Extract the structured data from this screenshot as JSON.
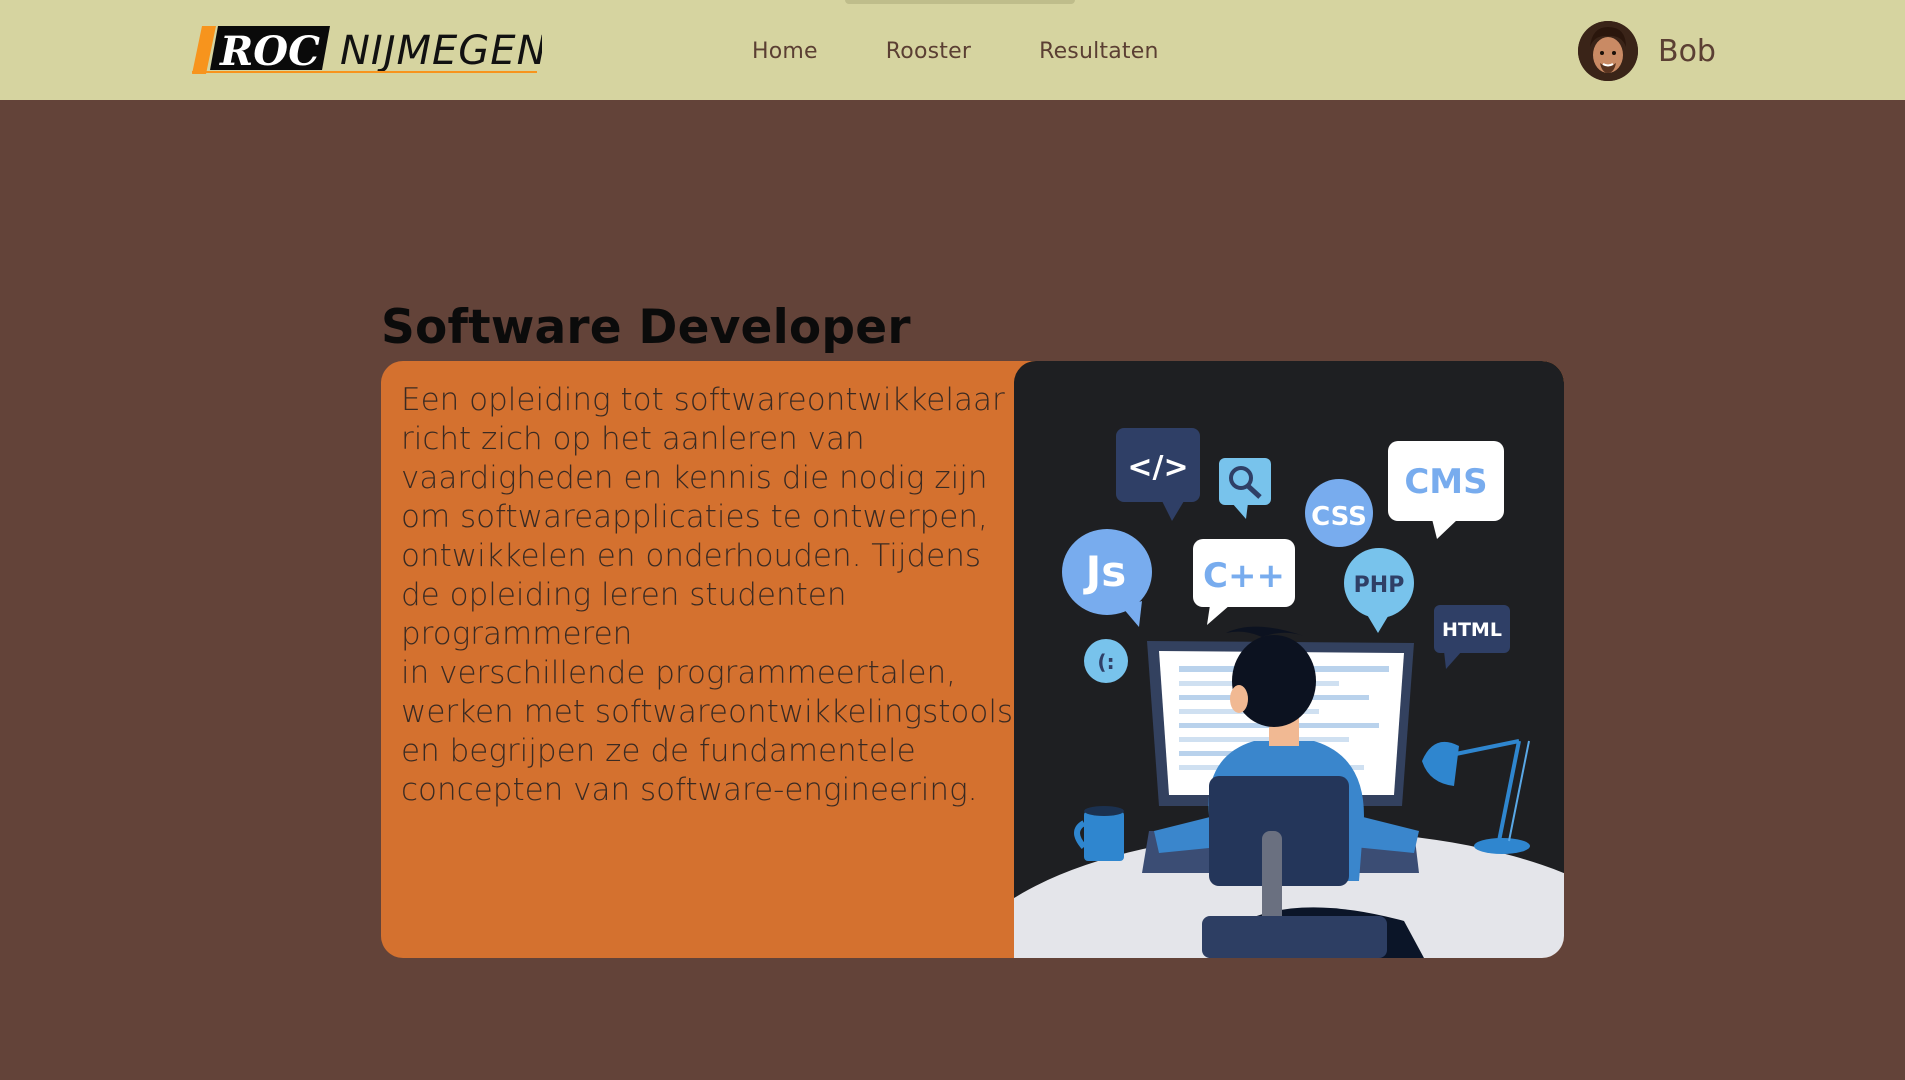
{
  "header": {
    "logo": {
      "brand": "ROC",
      "city": "NIJMEGEN"
    },
    "nav": [
      {
        "label": "Home"
      },
      {
        "label": "Rooster"
      },
      {
        "label": "Resultaten"
      }
    ],
    "user": {
      "name": "Bob"
    }
  },
  "main": {
    "title": "Software Developer",
    "description": "Een opleiding tot softwareontwikkelaar richt zich op het aanleren van\nvaardigheden en kennis die nodig zijn\nom softwareapplicaties te ontwerpen,\nontwikkelen en onderhouden. Tijdens\nde opleiding leren studenten\nprogrammeren\nin verschillende programmeertalen,\nwerken met softwareontwikkelingstools\nen begrijpen ze de fundamentele\nconcepten van software-engineering.",
    "illustration_labels": [
      "</>",
      "CSS",
      "CMS",
      "Js",
      "C++",
      "PHP",
      "HTML",
      "(:"
    ]
  },
  "colors": {
    "background": "#634339",
    "navbar": "#d6d4a0",
    "card": "#d4712f",
    "illustration_bg": "#1e1f22",
    "accent_orange": "#f7941d",
    "nav_text": "#5b3f33"
  }
}
